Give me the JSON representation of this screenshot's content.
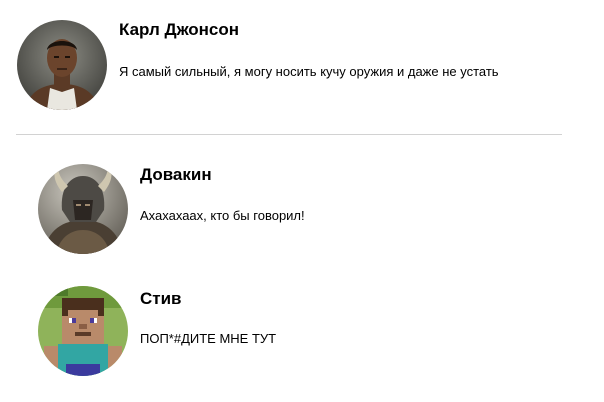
{
  "comments": [
    {
      "author": "Карл Джонсон",
      "avatar_icon": "cj-avatar",
      "text": "Я самый сильный, я могу носить кучу оружия и даже не устать"
    }
  ],
  "replies": [
    {
      "author": "Довакин",
      "avatar_icon": "dovahkiin-avatar",
      "text": "Ахахахаах, кто бы говорил!"
    },
    {
      "author": "Стив",
      "avatar_icon": "steve-avatar",
      "text": "ПОП*#ДИТЕ МНЕ ТУТ"
    }
  ],
  "colors": {
    "divider": "#d2d2d2",
    "text": "#000000"
  }
}
